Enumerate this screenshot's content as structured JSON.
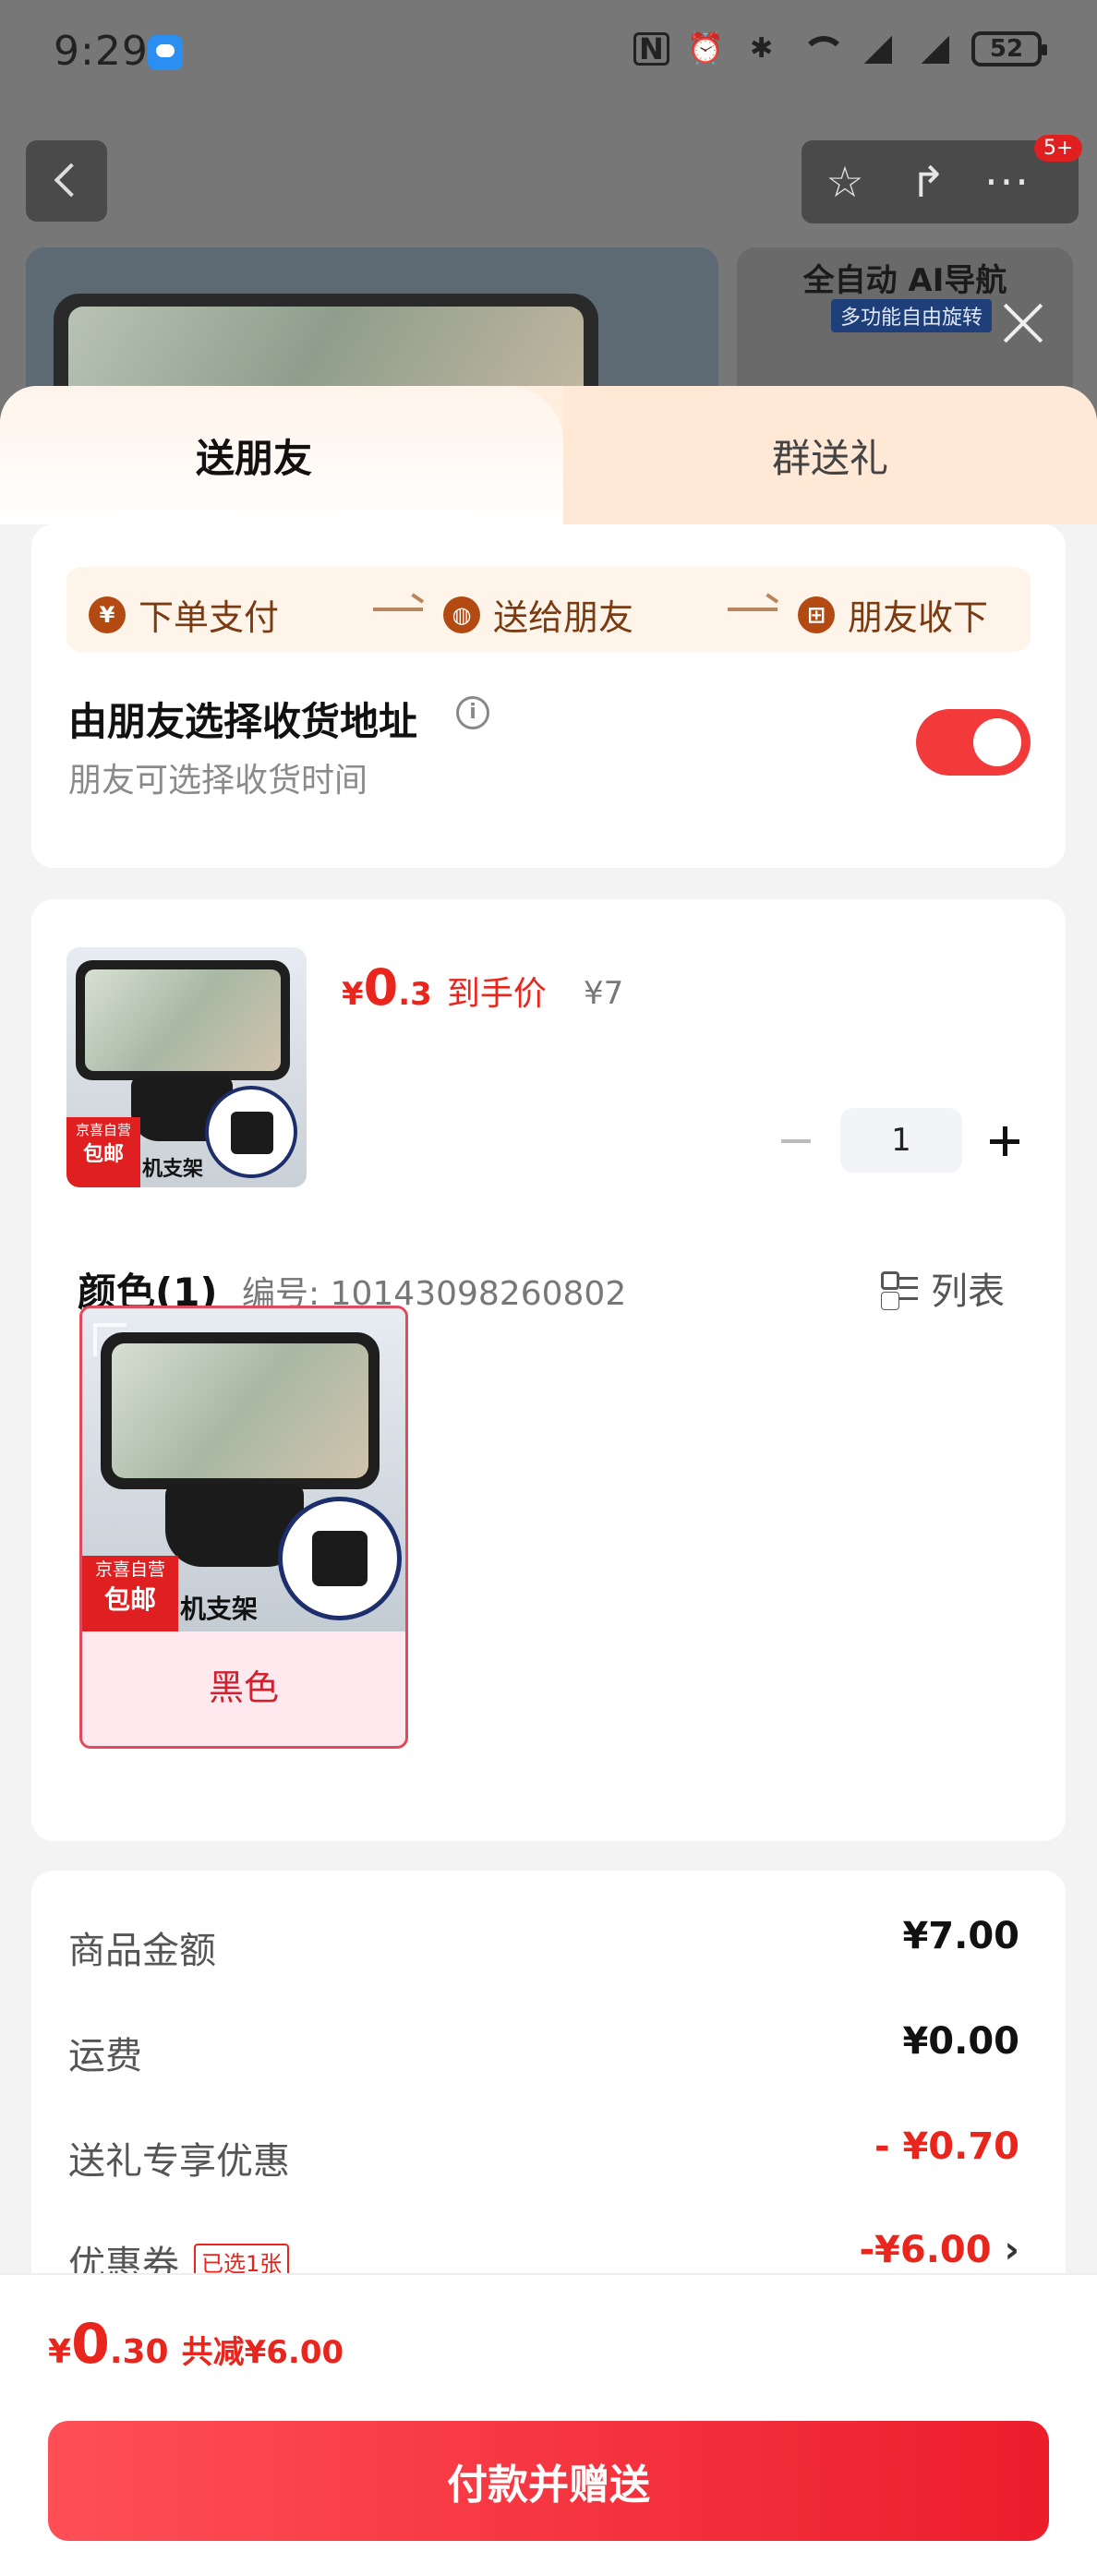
{
  "status_bar": {
    "time": "9:29",
    "battery": "52"
  },
  "top_bar": {
    "badge": "5+"
  },
  "background_banner": {
    "title": "全自动 AI导航",
    "tag": "多功能自由旋转"
  },
  "tabs": [
    {
      "label": "送朋友",
      "active": true
    },
    {
      "label": "群送礼",
      "active": false
    }
  ],
  "steps": [
    {
      "icon": "yen-icon",
      "label": "下单支付"
    },
    {
      "icon": "wechat-icon",
      "label": "送给朋友"
    },
    {
      "icon": "gift-icon",
      "label": "朋友收下"
    }
  ],
  "address": {
    "title": "由朋友选择收货地址",
    "subtitle": "朋友可选择收货时间",
    "toggle_on": true
  },
  "product": {
    "price_currency": "¥",
    "price_integer": "0",
    "price_decimal": ".3",
    "price_label": "到手价",
    "original_price": "¥7",
    "quantity": "1",
    "thumb_tag_top": "京喜自营",
    "thumb_tag_bottom": "包邮",
    "thumb_label": "机支架"
  },
  "color_section": {
    "title": "颜色(1)",
    "code": "编号: 10143098260802",
    "list_label": "列表",
    "variants": [
      {
        "name": "黑色",
        "selected": true
      }
    ]
  },
  "summary": {
    "rows": [
      {
        "label": "商品金额",
        "value": "¥7.00"
      },
      {
        "label": "运费",
        "value": "¥0.00"
      },
      {
        "label": "送礼专享优惠",
        "value": "- ¥0.70"
      },
      {
        "label": "优惠券",
        "chip": "已选1张",
        "value": "-¥6.00"
      }
    ]
  },
  "footer": {
    "currency": "¥",
    "integer": "0",
    "decimal": ".30",
    "savings": "共减¥6.00",
    "pay_button": "付款并赠送"
  },
  "colors": {
    "accent": "#e8261e",
    "toggle": "#f23a3a",
    "tab_bg": "#ffe8d6"
  }
}
